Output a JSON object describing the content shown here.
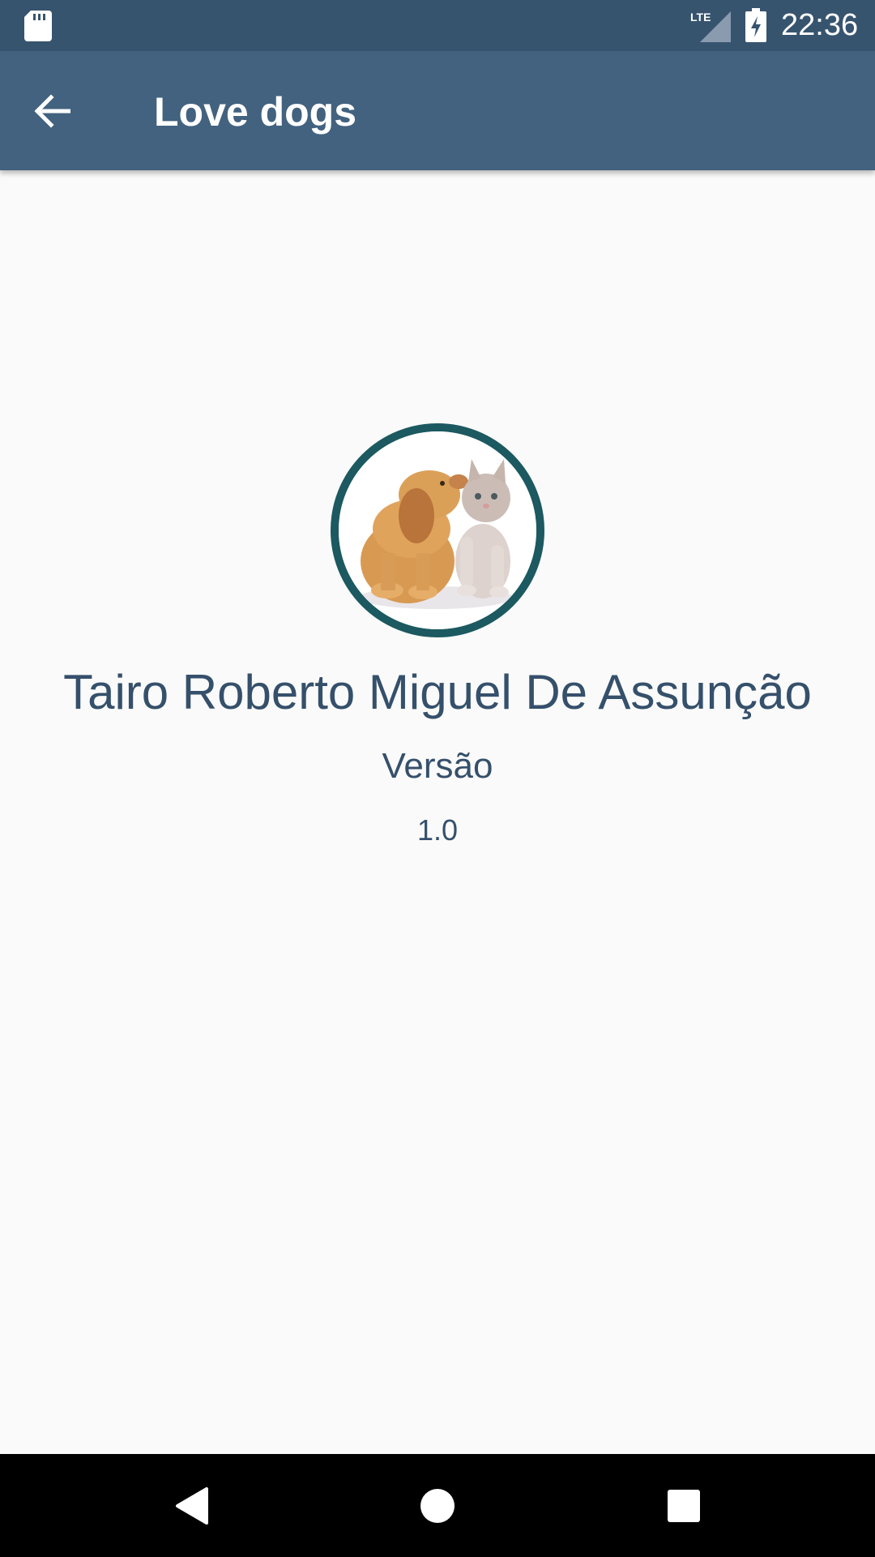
{
  "status_bar": {
    "time": "22:36",
    "network_label": "LTE",
    "icons": [
      "sd-card-icon",
      "lte-signal-icon",
      "battery-charging-icon"
    ]
  },
  "app_bar": {
    "title": "Love dogs",
    "back_icon": "arrow-back-icon"
  },
  "about": {
    "avatar_image": "puppy-and-kitten-photo",
    "author_name": "Tairo Roberto Miguel De Assunção",
    "version_label": "Versão",
    "version_value": "1.0"
  },
  "navigation_bar": {
    "buttons": [
      "back-triangle-icon",
      "home-circle-icon",
      "recents-square-icon"
    ]
  },
  "colors": {
    "status_bar": "#37546f",
    "app_bar": "#42627f",
    "text": "#35506b",
    "avatar_border": "#1c5960",
    "background": "#fafafa"
  }
}
